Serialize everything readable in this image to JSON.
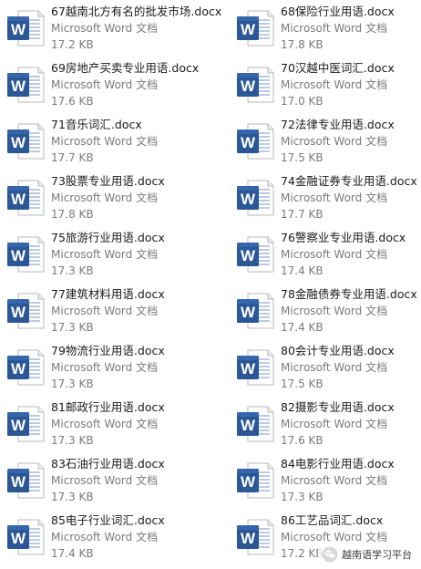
{
  "files": [
    {
      "name": "67越南北方有名的批发市场.docx",
      "type": "Microsoft Word 文档",
      "size": "17.2 KB",
      "icon": "word-document-icon"
    },
    {
      "name": "68保险行业用语.docx",
      "type": "Microsoft Word 文档",
      "size": "17.8 KB",
      "icon": "word-document-icon"
    },
    {
      "name": "69房地产买卖专业用语.docx",
      "type": "Microsoft Word 文档",
      "size": "17.6 KB",
      "icon": "word-document-icon"
    },
    {
      "name": "70汉越中医词汇.docx",
      "type": "Microsoft Word 文档",
      "size": "17.0 KB",
      "icon": "word-document-icon"
    },
    {
      "name": "71音乐词汇.docx",
      "type": "Microsoft Word 文档",
      "size": "17.7 KB",
      "icon": "word-document-icon"
    },
    {
      "name": "72法律专业用语.docx",
      "type": "Microsoft Word 文档",
      "size": "17.5 KB",
      "icon": "word-document-icon"
    },
    {
      "name": "73股票专业用语.docx",
      "type": "Microsoft Word 文档",
      "size": "17.8 KB",
      "icon": "word-document-icon"
    },
    {
      "name": "74金融证券专业用语.docx",
      "type": "Microsoft Word 文档",
      "size": "17.7 KB",
      "icon": "word-document-icon"
    },
    {
      "name": "75旅游行业用语.docx",
      "type": "Microsoft Word 文档",
      "size": "17.3 KB",
      "icon": "word-document-icon"
    },
    {
      "name": "76警察业专业用语.docx",
      "type": "Microsoft Word 文档",
      "size": "17.4 KB",
      "icon": "word-document-icon"
    },
    {
      "name": "77建筑材料用语.docx",
      "type": "Microsoft Word 文档",
      "size": "17.3 KB",
      "icon": "word-document-icon"
    },
    {
      "name": "78金融债券专业用语.docx",
      "type": "Microsoft Word 文档",
      "size": "17.4 KB",
      "icon": "word-document-icon"
    },
    {
      "name": "79物流行业用语.docx",
      "type": "Microsoft Word 文档",
      "size": "17.3 KB",
      "icon": "word-document-icon"
    },
    {
      "name": "80会计专业用语.docx",
      "type": "Microsoft Word 文档",
      "size": "17.5 KB",
      "icon": "word-document-icon"
    },
    {
      "name": "81邮政行业用语.docx",
      "type": "Microsoft Word 文档",
      "size": "17.3 KB",
      "icon": "word-document-icon"
    },
    {
      "name": "82摄影专业用语.docx",
      "type": "Microsoft Word 文档",
      "size": "17.6 KB",
      "icon": "word-document-icon"
    },
    {
      "name": "83石油行业用语.docx",
      "type": "Microsoft Word 文档",
      "size": "17.3 KB",
      "icon": "word-document-icon"
    },
    {
      "name": "84电影行业用语.docx",
      "type": "Microsoft Word 文档",
      "size": "17.3 KB",
      "icon": "word-document-icon"
    },
    {
      "name": "85电子行业词汇.docx",
      "type": "Microsoft Word 文档",
      "size": "17.4 KB",
      "icon": "word-document-icon"
    },
    {
      "name": "86工艺品词汇.docx",
      "type": "Microsoft Word 文档",
      "size": "17.2 KB",
      "icon": "word-document-icon"
    }
  ],
  "watermark": {
    "text": "越南语学习平台",
    "icon": "wechat-logo-icon"
  },
  "colors": {
    "word_blue": "#2b5797",
    "text": "#1a1a1a",
    "subtext": "#7a7a7a"
  }
}
